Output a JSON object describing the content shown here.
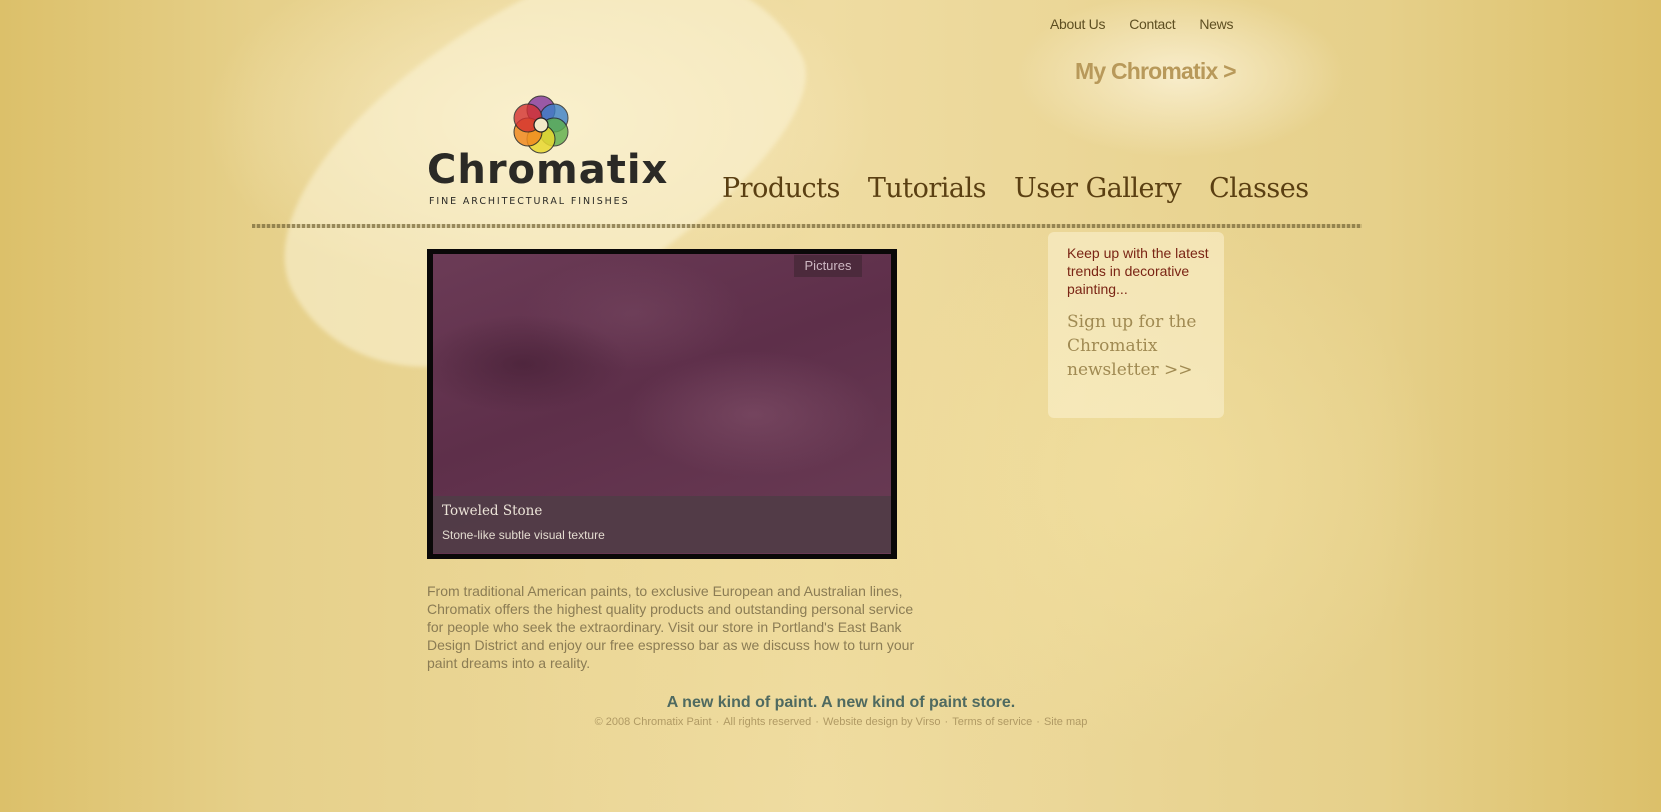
{
  "top_nav": {
    "about": "About Us",
    "contact": "Contact",
    "news": "News"
  },
  "my_chromatix": "My Chromatix >",
  "logo": {
    "name": "Chromatix",
    "tagline": "FINE ARCHITECTURAL FINISHES"
  },
  "main_nav": {
    "products": "Products",
    "tutorials": "Tutorials",
    "gallery": "User Gallery",
    "classes": "Classes"
  },
  "slideshow": {
    "tab": "Pictures",
    "title": "Toweled Stone",
    "description": "Stone-like subtle visual texture"
  },
  "intro_text": "From traditional American paints, to exclusive European and Australian lines, Chromatix offers the highest quality products and outstanding personal service for people who seek the extraordinary. Visit our store in Portland's East Bank Design District and enjoy our free espresso bar as we discuss how to turn your paint dreams into a reality.",
  "newsletter": {
    "teaser": "Keep up with the latest trends in decorative painting...",
    "signup": "Sign up for the Chromatix newsletter >>"
  },
  "footer": {
    "tagline": "A new kind of paint. A new kind of paint store.",
    "copyright": "© 2008 Chromatix Paint",
    "rights": "All rights reserved",
    "design": "Website design by Virso",
    "terms": "Terms of service",
    "sitemap": "Site map",
    "separator": "·"
  },
  "colors": {
    "background": "#e3cd82",
    "nav_text": "#5a3f12",
    "teaser_text": "#7a2414",
    "tagline_text": "#4f6a60",
    "slide_purple": "#5e2f4a"
  }
}
